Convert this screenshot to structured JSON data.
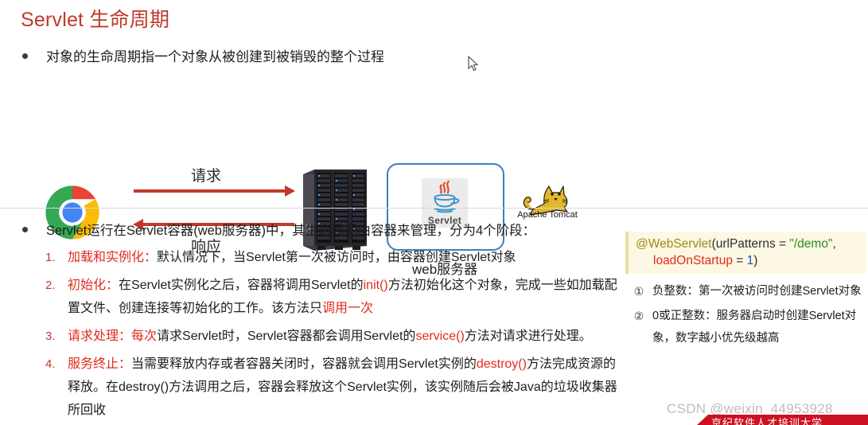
{
  "title": "Servlet 生命周期",
  "top_bullet": "对象的生命周期指一个对象从被创建到被销毁的整个过程",
  "diagram": {
    "browser_icon": "chrome-logo",
    "request_label": "请求",
    "response_label": "响应",
    "server_icon": "server-rack-icon",
    "servlet_logo_label": "Servlet",
    "webserver_label": "web服务器",
    "tomcat_label": "Apache Tomcat",
    "box_border_color": "#3d7ebf",
    "arrow_color": "#c0392b"
  },
  "main_bullet": "Servlet运行在Servlet容器(web服务器)中，其生命周期由容器来管理，分为4个阶段：",
  "steps": [
    {
      "num": "1.",
      "parts": [
        {
          "text": "加载和实例化：",
          "style": "hl"
        },
        {
          "text": "默认情况下，当Servlet第一次被访问时，由容器创建Servlet对象",
          "style": "plain"
        }
      ]
    },
    {
      "num": "2.",
      "parts": [
        {
          "text": "初始化：",
          "style": "hl"
        },
        {
          "text": "在Servlet实例化之后，容器将调用Servlet的",
          "style": "plain"
        },
        {
          "text": "init()",
          "style": "hl"
        },
        {
          "text": "方法初始化这个对象，完成一些如加载配置文件、创建连接等初始化的工作。该方法只",
          "style": "plain"
        },
        {
          "text": "调用一次",
          "style": "hl"
        }
      ]
    },
    {
      "num": "3.",
      "parts": [
        {
          "text": "请求处理：",
          "style": "hl"
        },
        {
          "text": "每次",
          "style": "hl"
        },
        {
          "text": "请求Servlet时，Servlet容器都会调用Servlet的",
          "style": "plain"
        },
        {
          "text": "service()",
          "style": "hl"
        },
        {
          "text": "方法对请求进行处理。",
          "style": "plain"
        }
      ]
    },
    {
      "num": "4.",
      "parts": [
        {
          "text": "服务终止：",
          "style": "hl"
        },
        {
          "text": "当需要释放内存或者容器关闭时，容器就会调用Servlet实例的",
          "style": "plain"
        },
        {
          "text": "destroy()",
          "style": "hl"
        },
        {
          "text": "方法完成资源的释放。在destroy()方法调用之后，容器会释放这个Servlet实例，该实例随后会被Java的垃圾收集器所回收",
          "style": "plain"
        }
      ]
    }
  ],
  "code_box": {
    "line1": [
      {
        "text": "@WebServlet",
        "style": "ann"
      },
      {
        "text": "(urlPatterns = ",
        "style": "pln"
      },
      {
        "text": "\"/demo\"",
        "style": "str"
      },
      {
        "text": ",",
        "style": "pln"
      }
    ],
    "line2": [
      {
        "text": "loadOnStartup",
        "style": "fld"
      },
      {
        "text": " = ",
        "style": "pln"
      },
      {
        "text": "1",
        "style": "num"
      },
      {
        "text": ")",
        "style": "pln"
      }
    ],
    "bg_color": "#fdf8e3",
    "border_color": "#e8dda0"
  },
  "notes": [
    {
      "num": "①",
      "text": "负整数：第一次被访问时创建Servlet对象"
    },
    {
      "num": "②",
      "text": "0或正整数：服务器启动时创建Servlet对象，数字越小优先级越高"
    }
  ],
  "watermark": "CSDN @weixin_44953928",
  "red_banner": "京纪软件人才培训大学"
}
